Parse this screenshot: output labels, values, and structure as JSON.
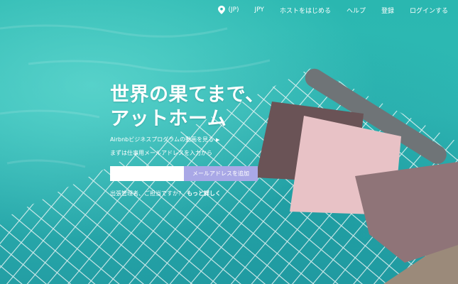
{
  "nav": {
    "region_label": "(JP)",
    "currency_label": "JPY",
    "host_label": "ホストをはじめる",
    "help_label": "ヘルプ",
    "signup_label": "登録",
    "login_label": "ログインする",
    "icons": {
      "region": "location-pin-icon"
    }
  },
  "hero": {
    "headline_line1": "世界の果てまで、",
    "headline_line2": "アットホーム",
    "promo_link": "Airbnbビジネスプログラムの動画を見る",
    "email_prompt": "まずは仕事用メールアドレスを入力から",
    "email_placeholder": "",
    "email_button": "メールアドレスを追加",
    "business_question": "出張管理者、ご担当ですか？",
    "learn_more": "もっと詳しく"
  },
  "colors": {
    "water": "#2fb7b1",
    "button": "#a9a8e6",
    "text": "#ffffff"
  }
}
